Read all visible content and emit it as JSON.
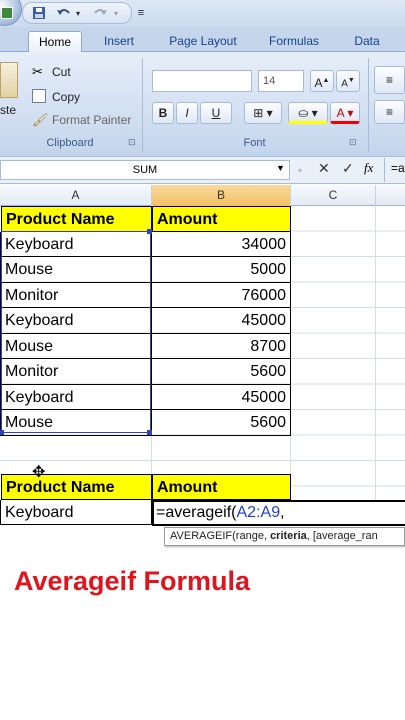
{
  "ribbon": {
    "tabs": [
      {
        "label": "Home"
      },
      {
        "label": "Insert"
      },
      {
        "label": "Page Layout"
      },
      {
        "label": "Formulas"
      },
      {
        "label": "Data"
      }
    ],
    "clipboard": {
      "paste_label": "ste",
      "cut_label": "Cut",
      "copy_label": "Copy",
      "format_painter_label": "Format Painter",
      "group_label": "Clipboard"
    },
    "font": {
      "font_size": "14",
      "group_label": "Font",
      "bold": "B",
      "italic": "I",
      "underline": "U"
    }
  },
  "formula_bar": {
    "name_box": "SUM",
    "cancel": "✕",
    "enter": "✓",
    "fx": "fx",
    "content": "=a"
  },
  "columns": [
    "A",
    "B",
    "C"
  ],
  "table1": {
    "header": [
      "Product Name",
      "Amount"
    ],
    "rows": [
      [
        "Keyboard",
        "34000"
      ],
      [
        "Mouse",
        "5000"
      ],
      [
        "Monitor",
        "76000"
      ],
      [
        "Keyboard",
        "45000"
      ],
      [
        "Mouse",
        "8700"
      ],
      [
        "Monitor",
        "5600"
      ],
      [
        "Keyboard",
        "45000"
      ],
      [
        "Mouse",
        "5600"
      ]
    ]
  },
  "table2": {
    "header": [
      "Product Name",
      "Amount"
    ],
    "product": "Keyboard",
    "formula_prefix": "=averageif(",
    "formula_ref": "A2:A9",
    "formula_suffix": ","
  },
  "tooltip": {
    "fn": "AVERAGEIF(range, ",
    "bold": "criteria",
    "rest": ", [average_ran"
  },
  "caption": "Averageif Formula",
  "colors": {
    "header_fill": "#ffff00",
    "caption": "#e1141c",
    "ref": "#1f3fd1"
  }
}
